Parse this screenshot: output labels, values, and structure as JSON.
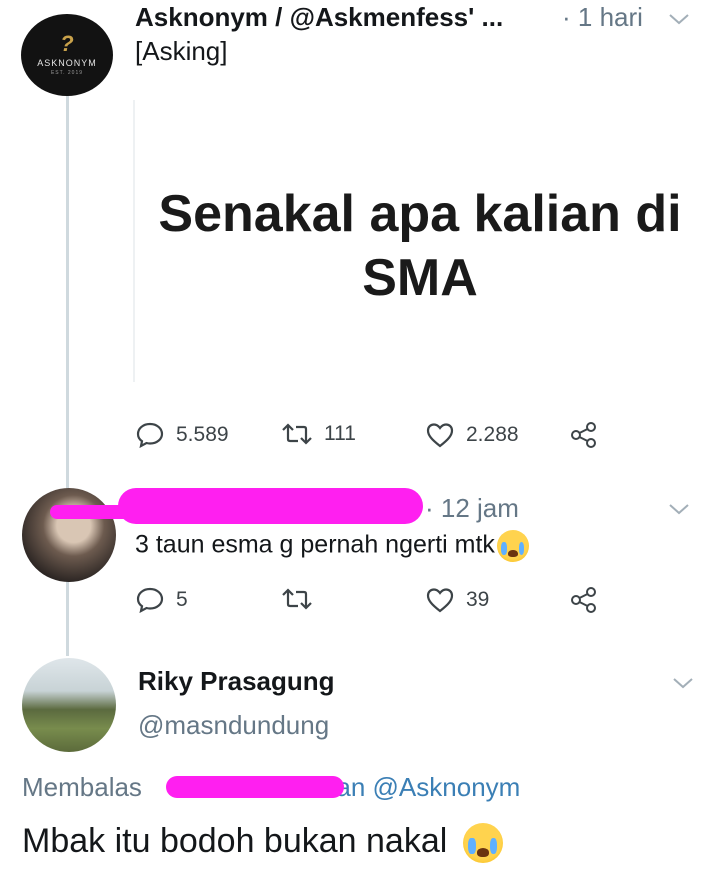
{
  "tweet1": {
    "avatar_text": "ASKNONYM",
    "avatar_sub": "EST. 2019",
    "author": "Asknonym / @Askmenfess' ...",
    "time": "· 1 hari",
    "text": "[Asking]",
    "card_text": "Senakal apa kalian di SMA",
    "replies": "5.589",
    "retweets": "111",
    "likes": "2.288"
  },
  "tweet2": {
    "time": "· 12 jam",
    "text": "3 taun esma g pernah ngerti mtk",
    "replies": "5",
    "likes": "39"
  },
  "tweet3": {
    "author": "Riky Prasagung",
    "handle": "@masndundung",
    "replying_prefix": "Membalas",
    "replying_mention": "dan @Asknonym",
    "text": "Mbak itu bodoh bukan nakal"
  },
  "colors": {
    "redaction": "#ff1ff0",
    "muted": "#657786",
    "mention": "#3b7fb5"
  }
}
